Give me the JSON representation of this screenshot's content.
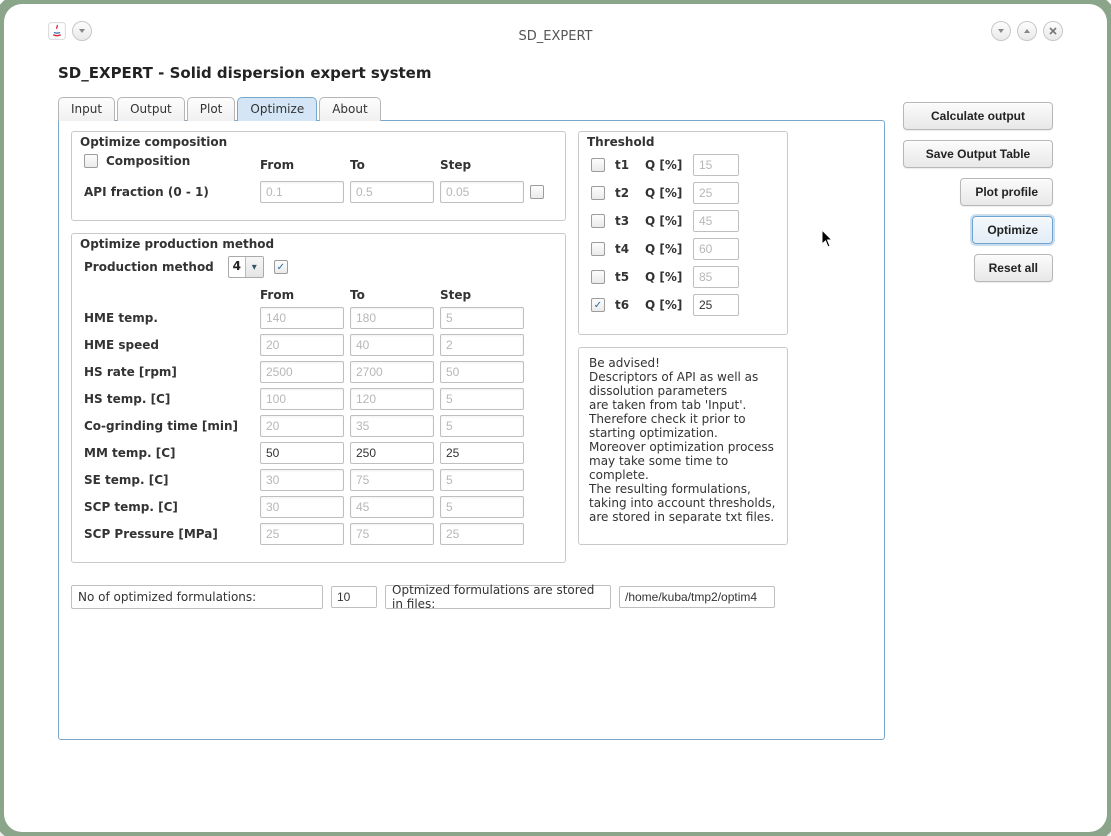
{
  "window": {
    "title": "SD_EXPERT",
    "subtitle": "SD_EXPERT - Solid dispersion expert system"
  },
  "tabs": {
    "items": [
      {
        "label": "Input"
      },
      {
        "label": "Output"
      },
      {
        "label": "Plot"
      },
      {
        "label": "Optimize"
      },
      {
        "label": "About"
      }
    ],
    "active_index": 3
  },
  "sidebar": {
    "buttons": {
      "calc": "Calculate output",
      "save": "Save Output Table",
      "plot": "Plot profile",
      "optimize": "Optimize",
      "reset": "Reset all"
    }
  },
  "optimize": {
    "composition": {
      "legend": "Optimize composition",
      "chk_label": "Composition",
      "headers": {
        "from": "From",
        "to": "To",
        "step": "Step"
      },
      "api_label": "API fraction (0 - 1)",
      "api": {
        "from": "0.1",
        "to": "0.5",
        "step": "0.05"
      }
    },
    "production": {
      "legend": "Optimize production method",
      "selector_label": "Production method",
      "selector_value": "4",
      "headers": {
        "from": "From",
        "to": "To",
        "step": "Step"
      },
      "params": [
        {
          "label": "HME temp.",
          "from": "140",
          "to": "180",
          "step": "5",
          "enabled": false
        },
        {
          "label": "HME speed",
          "from": "20",
          "to": "40",
          "step": "2",
          "enabled": false
        },
        {
          "label": "HS rate [rpm]",
          "from": "2500",
          "to": "2700",
          "step": "50",
          "enabled": false
        },
        {
          "label": "HS temp. [C]",
          "from": "100",
          "to": "120",
          "step": "5",
          "enabled": false
        },
        {
          "label": "Co-grinding time [min]",
          "from": "20",
          "to": "35",
          "step": "5",
          "enabled": false
        },
        {
          "label": "MM temp. [C]",
          "from": "50",
          "to": "250",
          "step": "25",
          "enabled": true
        },
        {
          "label": "SE temp. [C]",
          "from": "30",
          "to": "75",
          "step": "5",
          "enabled": false
        },
        {
          "label": "SCP temp. [C]",
          "from": "30",
          "to": "45",
          "step": "5",
          "enabled": false
        },
        {
          "label": "SCP Pressure [MPa]",
          "from": "25",
          "to": "75",
          "step": "25",
          "enabled": false
        }
      ]
    },
    "threshold": {
      "legend": "Threshold",
      "qlabel": "Q [%]",
      "rows": [
        {
          "t": "t1",
          "q": "15",
          "checked": false
        },
        {
          "t": "t2",
          "q": "25",
          "checked": false
        },
        {
          "t": "t3",
          "q": "45",
          "checked": false
        },
        {
          "t": "t4",
          "q": "60",
          "checked": false
        },
        {
          "t": "t5",
          "q": "85",
          "checked": false
        },
        {
          "t": "t6",
          "q": "25",
          "checked": true
        }
      ]
    },
    "advisory": "Be advised!\nDescriptors of API as well as dissolution parameters\nare taken from tab 'Input'.\nTherefore check it prior to starting optimization.\nMoreover optimization process may take some time to complete.\nThe resulting formulations,\ntaking into account thresholds,\nare stored in separate txt files.",
    "footer": {
      "count_label": "No of optimized formulations:",
      "count_value": "10",
      "path_label": "Optmized formulations are stored in files:",
      "path_value": "/home/kuba/tmp2/optim4"
    }
  }
}
